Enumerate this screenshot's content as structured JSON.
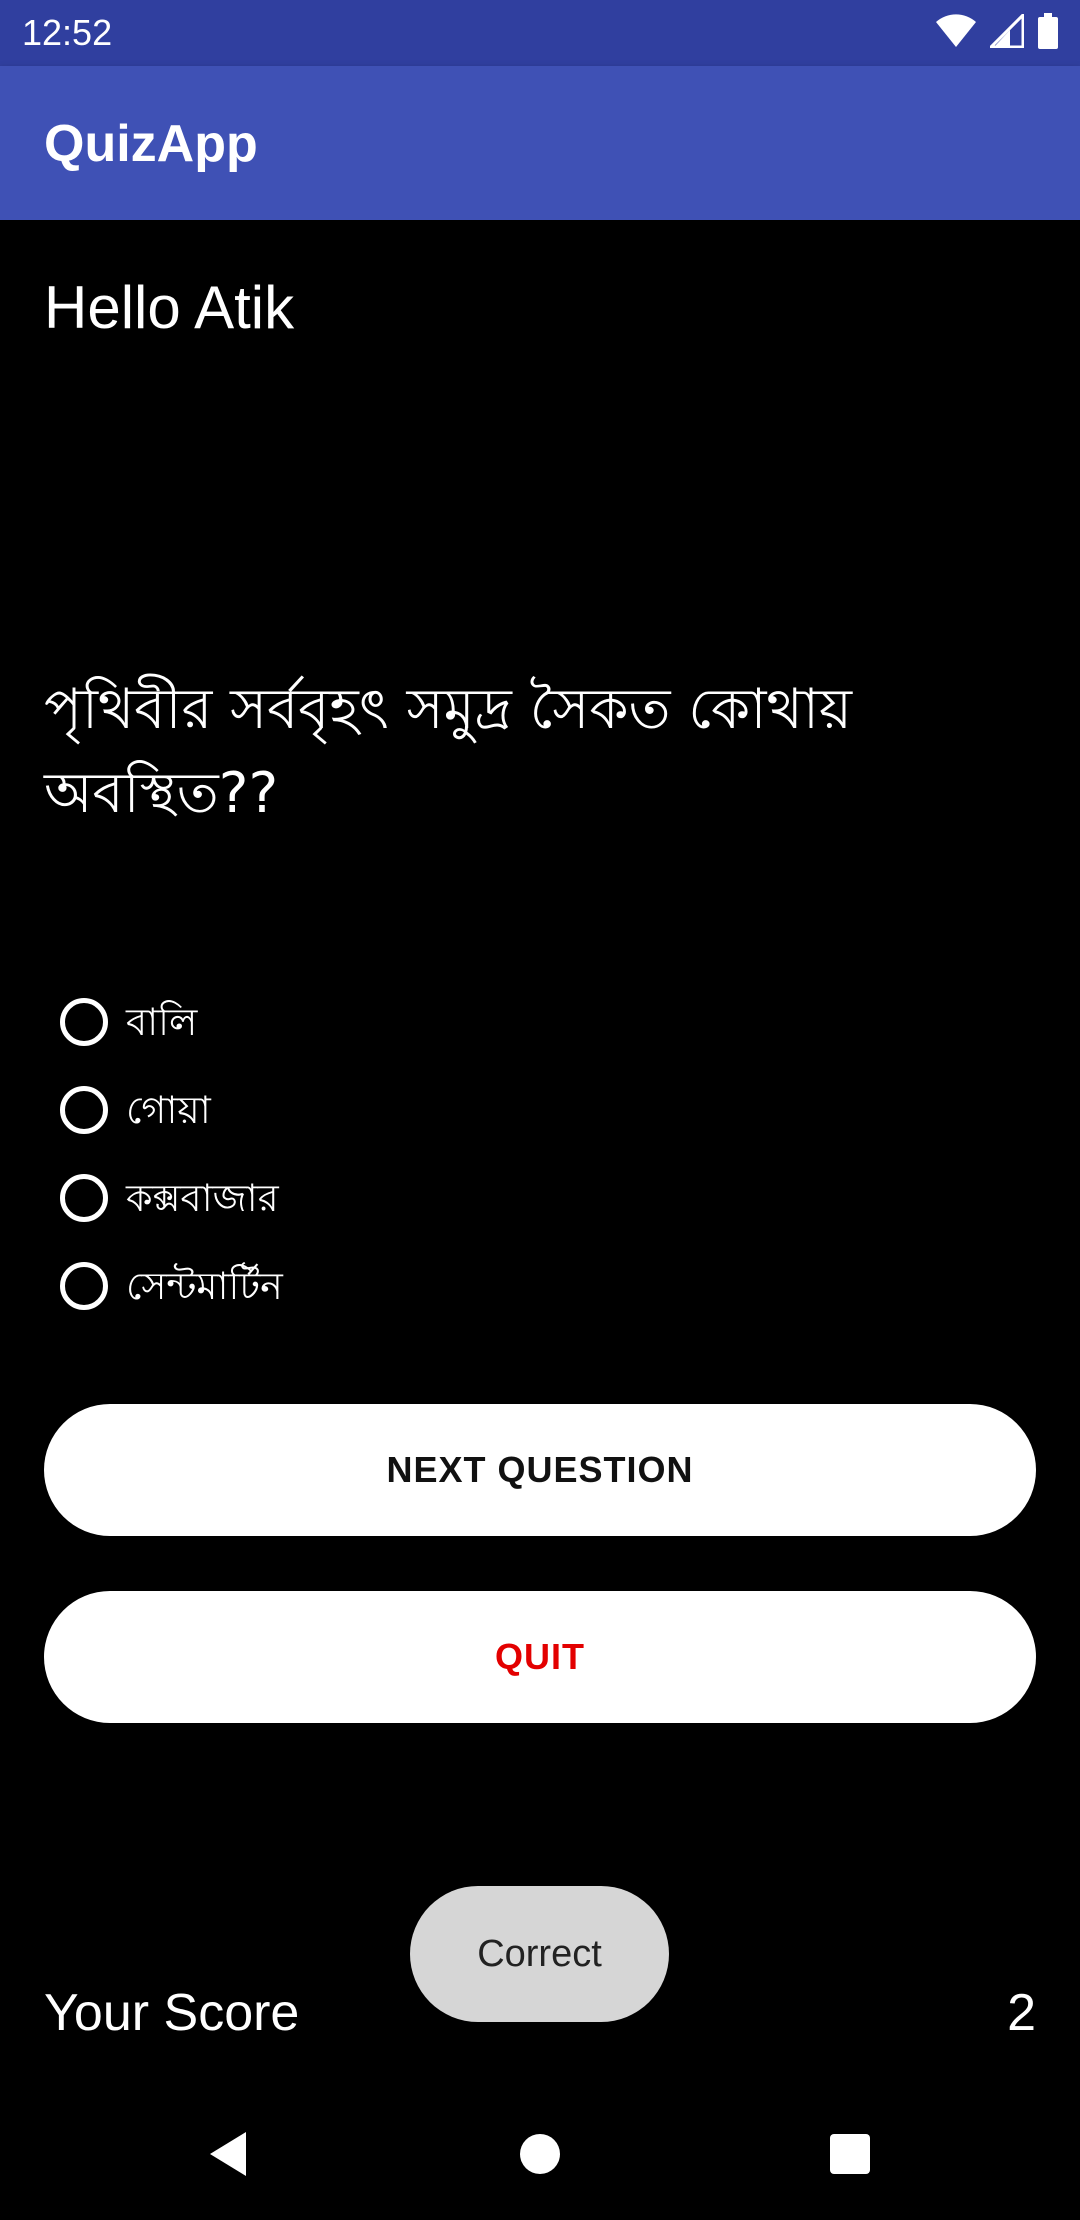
{
  "status_bar": {
    "time": "12:52",
    "icons": [
      "wifi-icon",
      "cellular-signal-icon",
      "battery-icon"
    ]
  },
  "app_bar": {
    "title": "QuizApp"
  },
  "greeting": "Hello Atik",
  "question": "পৃথিবীর সর্ববৃহৎ সমুদ্র সৈকত কোথায় অবস্থিত??",
  "options": [
    {
      "label": "বালি",
      "selected": false
    },
    {
      "label": "গোয়া",
      "selected": false
    },
    {
      "label": "কক্সবাজার",
      "selected": false
    },
    {
      "label": "সেন্টমার্টিন",
      "selected": false
    }
  ],
  "buttons": {
    "next_label": "NEXT QUESTION",
    "quit_label": "QUIT"
  },
  "score": {
    "label": "Your Score",
    "value": "2"
  },
  "toast": {
    "message": "Correct"
  },
  "nav_bar": {
    "icons": [
      "back-icon",
      "home-icon",
      "recents-icon"
    ]
  },
  "colors": {
    "status_bar": "#303F9F",
    "app_bar": "#3F51B5",
    "background": "#000000",
    "quit_text": "#E30000",
    "toast_bg": "#D6D6D6"
  }
}
